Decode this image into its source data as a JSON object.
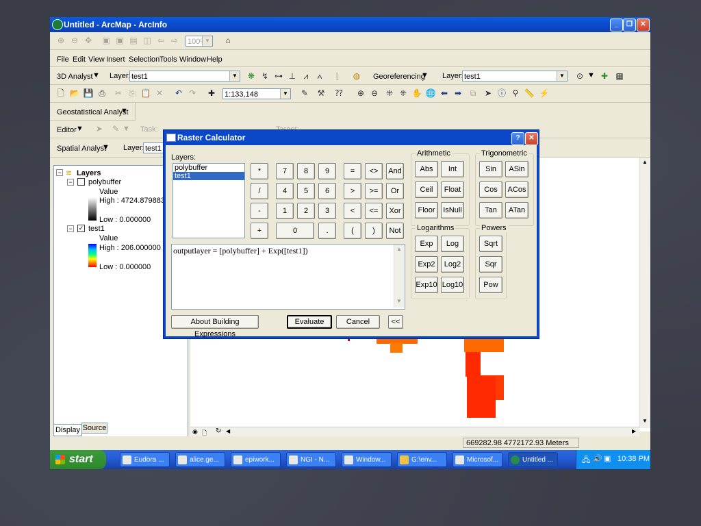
{
  "window": {
    "title": "Untitled - ArcMap - ArcInfo",
    "zoom": "100%"
  },
  "menu": [
    "File",
    "Edit",
    "View",
    "Insert",
    "Selection",
    "Tools",
    "Window",
    "Help"
  ],
  "toolbar3d": {
    "label": "3D Analyst",
    "layer_label": "Layer:",
    "layer_value": "test1"
  },
  "georef": {
    "label": "Georeferencing",
    "layer_label": "Layer:",
    "layer_value": "test1"
  },
  "standard": {
    "scale": "1:133,148"
  },
  "geostat": {
    "label": "Geostatistical Analyst"
  },
  "editor": {
    "label": "Editor",
    "task_label": "Task:",
    "target_label": "Target:"
  },
  "spatial": {
    "label": "Spatial Analyst",
    "layer_label": "Layer:",
    "layer_value": "test1"
  },
  "toc": {
    "root": "Layers",
    "layers": [
      {
        "name": "polybuffer",
        "checked": false,
        "field": "Value",
        "high": "High : 4724.879883",
        "low": "Low : 0.000000"
      },
      {
        "name": "test1",
        "checked": true,
        "field": "Value",
        "high": "High : 206.000000",
        "low": "Low : 0.000000"
      }
    ],
    "tabs": [
      "Display",
      "Source"
    ]
  },
  "status": {
    "coords": "669282.98  4772172.93 Meters"
  },
  "taskbar": {
    "start": "start",
    "tasks": [
      "Eudora ...",
      "alice.ge...",
      "epiwork...",
      "NGI - N...",
      "Window...",
      "G:\\env...",
      "Microsof...",
      "Untitled ..."
    ],
    "clock": "10:38 PM"
  },
  "dialog": {
    "title": "Raster Calculator",
    "layers_label": "Layers:",
    "layers": [
      "polybuffer",
      "test1"
    ],
    "selected_layer": "test1",
    "keypad": [
      [
        "*",
        "7",
        "8",
        "9",
        "=",
        "<>",
        "And"
      ],
      [
        "/",
        "4",
        "5",
        "6",
        ">",
        ">=",
        "Or"
      ],
      [
        "-",
        "1",
        "2",
        "3",
        "<",
        "<=",
        "Xor"
      ],
      [
        "+",
        "0",
        ".",
        "(",
        ")",
        "Not"
      ]
    ],
    "arithmetic": {
      "label": "Arithmetic",
      "buttons": [
        "Abs",
        "Int",
        "Ceil",
        "Float",
        "Floor",
        "IsNull"
      ]
    },
    "trigonometric": {
      "label": "Trigonometric",
      "buttons": [
        "Sin",
        "ASin",
        "Cos",
        "ACos",
        "Tan",
        "ATan"
      ]
    },
    "logarithms": {
      "label": "Logarithms",
      "buttons": [
        "Exp",
        "Log",
        "Exp2",
        "Log2",
        "Exp10",
        "Log10"
      ]
    },
    "powers": {
      "label": "Powers",
      "buttons": [
        "Sqrt",
        "Sqr",
        "Pow"
      ]
    },
    "expression": "outputlayer = [polybuffer] + Exp([test1])",
    "about_button": "About Building Expressions",
    "evaluate_button": "Evaluate",
    "cancel_button": "Cancel",
    "collapse_button": "<<"
  },
  "colors": {
    "title_blue": "#0b48c8",
    "raster_orange": "#ff6a00",
    "raster_red": "#ff2a00"
  }
}
